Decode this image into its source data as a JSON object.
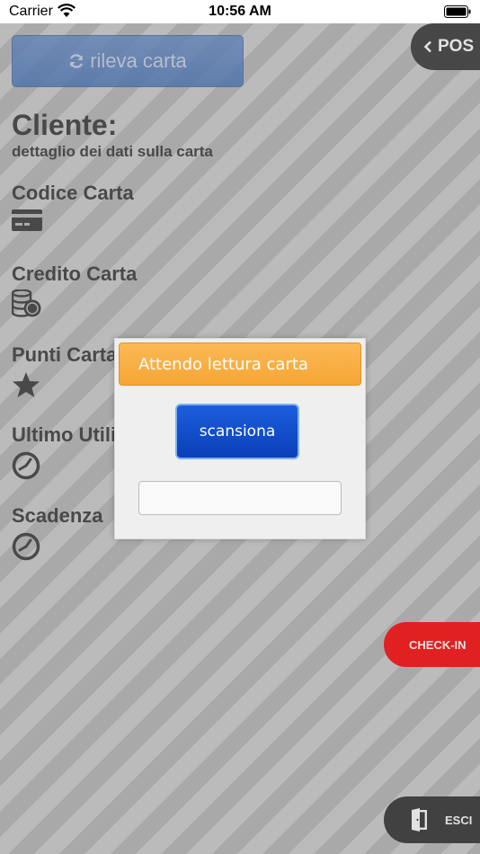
{
  "status_bar": {
    "carrier": "Carrier",
    "time": "10:56 AM"
  },
  "header": {
    "rileva_label": "rileva carta",
    "pos_label": "POS"
  },
  "client": {
    "title": "Cliente:",
    "subtitle": "dettaglio dei dati sulla carta",
    "fields": [
      {
        "label": "Codice Carta",
        "icon": "credit-card-icon"
      },
      {
        "label": "Credito Carta",
        "icon": "coins-icon"
      },
      {
        "label": "Punti Carta",
        "icon": "star-icon"
      },
      {
        "label": "Ultimo Utilizzo",
        "icon": "clock-icon"
      },
      {
        "label": "Scadenza",
        "icon": "clock-icon"
      }
    ]
  },
  "side_buttons": {
    "checkin_label": "CHECK-IN",
    "esci_label": "ESCI"
  },
  "modal": {
    "title": "Attendo lettura carta",
    "scan_label": "scansiona",
    "input_value": ""
  }
}
